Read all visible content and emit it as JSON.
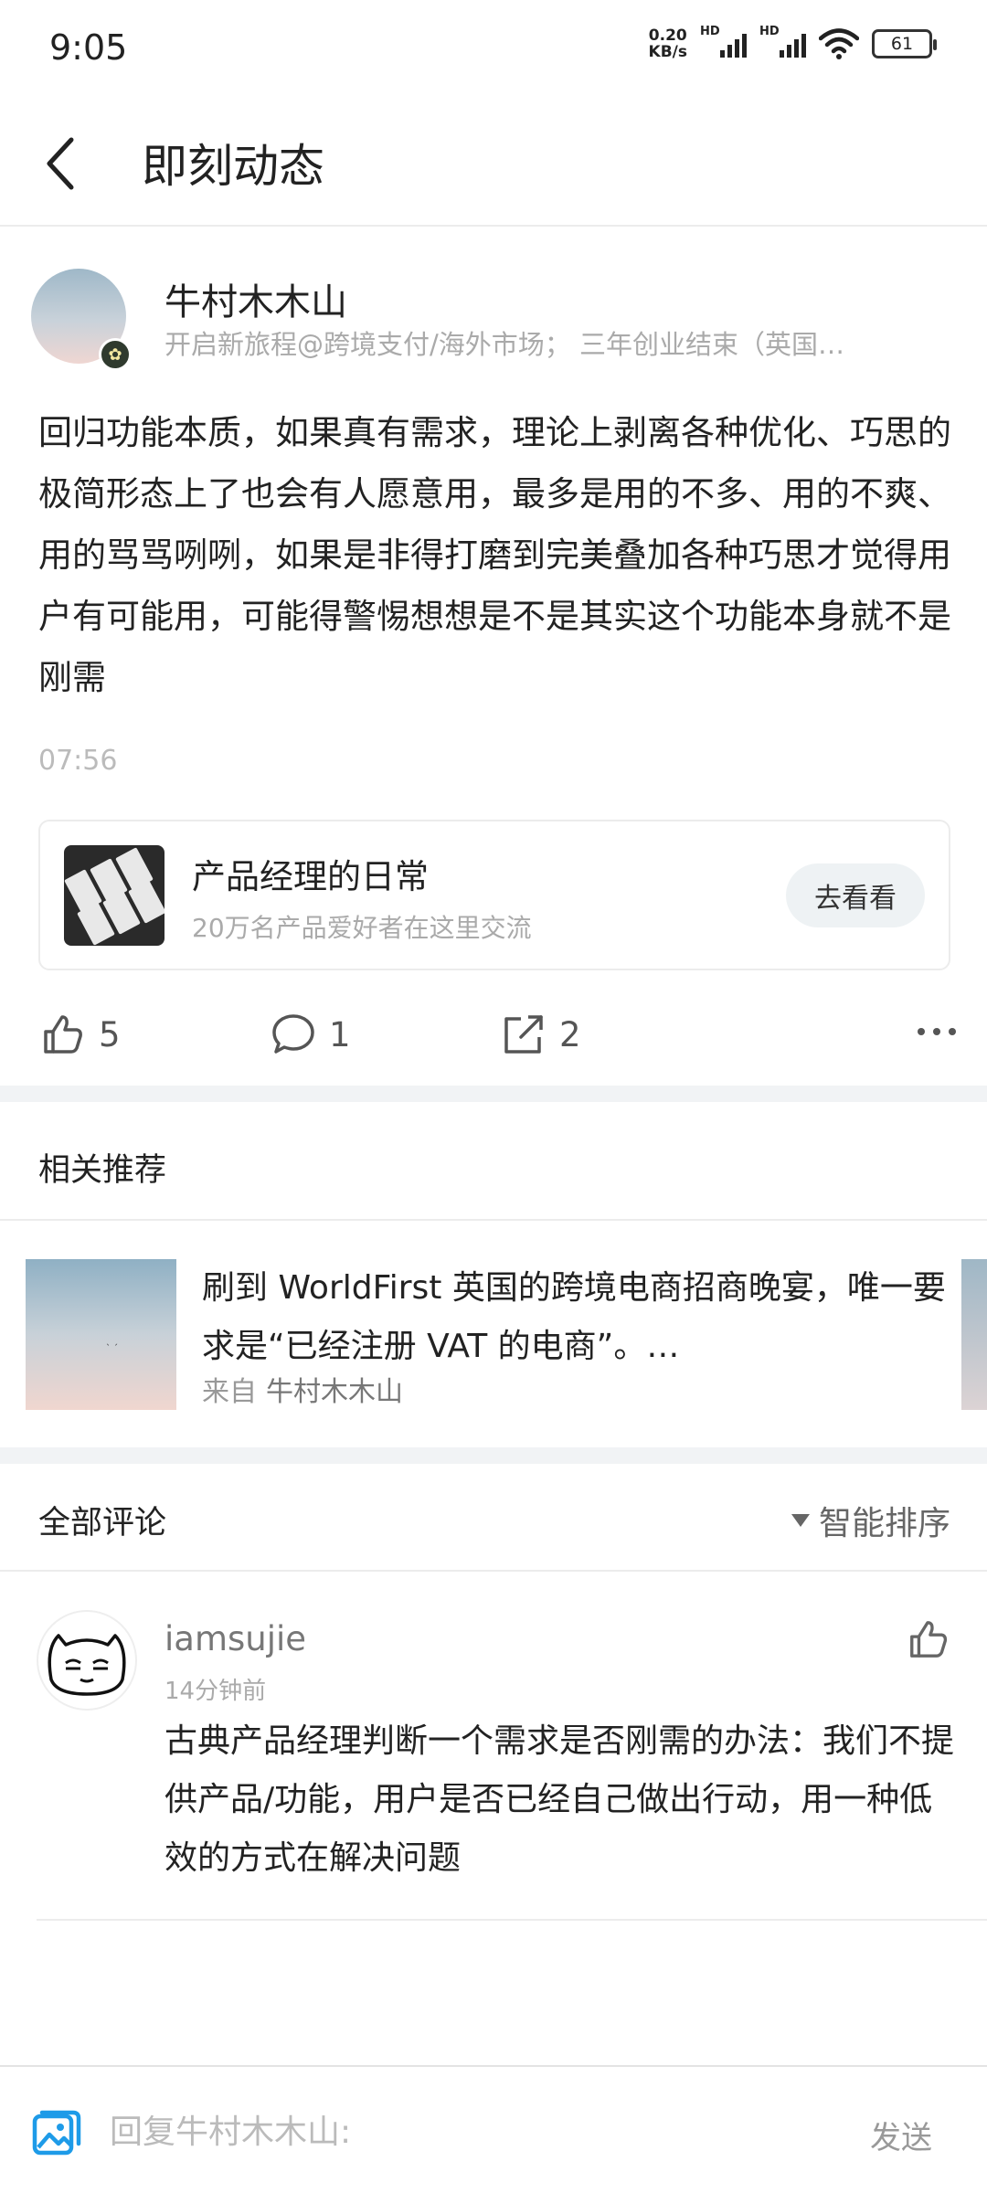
{
  "status_bar": {
    "time": "9:05",
    "net_speed_value": "0.20",
    "net_speed_unit": "KB/s",
    "sim1": "HD",
    "sim2": "HD",
    "battery": "61"
  },
  "header": {
    "title": "即刻动态"
  },
  "post": {
    "author": "牛村木木山",
    "bio": "开启新旅程@跨境支付/海外市场；  三年创业结束（英国…",
    "content": "回归功能本质，如果真有需求，理论上剥离各种优化、巧思的极简形态上了也会有人愿意用，最多是用的不多、用的不爽、用的骂骂咧咧，如果是非得打磨到完美叠加各种巧思才觉得用户有可能用，可能得警惕想想是不是其实这个功能本身就不是刚需",
    "time": "07:56",
    "circle": {
      "name": "产品经理的日常",
      "desc": "20万名产品爱好者在这里交流",
      "button": "去看看"
    },
    "likes": "5",
    "comments": "1",
    "shares": "2"
  },
  "related": {
    "title": "相关推荐",
    "items": [
      {
        "text": "刷到 WorldFirst 英国的跨境电商招商晚宴，唯一要求是“已经注册 VAT 的电商”。…",
        "source_label": "来自",
        "source_name": "牛村木木山"
      }
    ]
  },
  "comments": {
    "title": "全部评论",
    "sort_label": "智能排序",
    "items": [
      {
        "user": "iamsujie",
        "time": "14分钟前",
        "text": "古典产品经理判断一个需求是否刚需的办法：我们不提供产品/功能，用户是否已经自己做出行动，用一种低效的方式在解决问题"
      }
    ]
  },
  "reply_bar": {
    "placeholder": "回复牛村木木山:",
    "send": "发送"
  },
  "colors": {
    "accent_blue": "#1e9be8",
    "divider": "#f1f3f5",
    "muted": "#aaaaaa"
  }
}
